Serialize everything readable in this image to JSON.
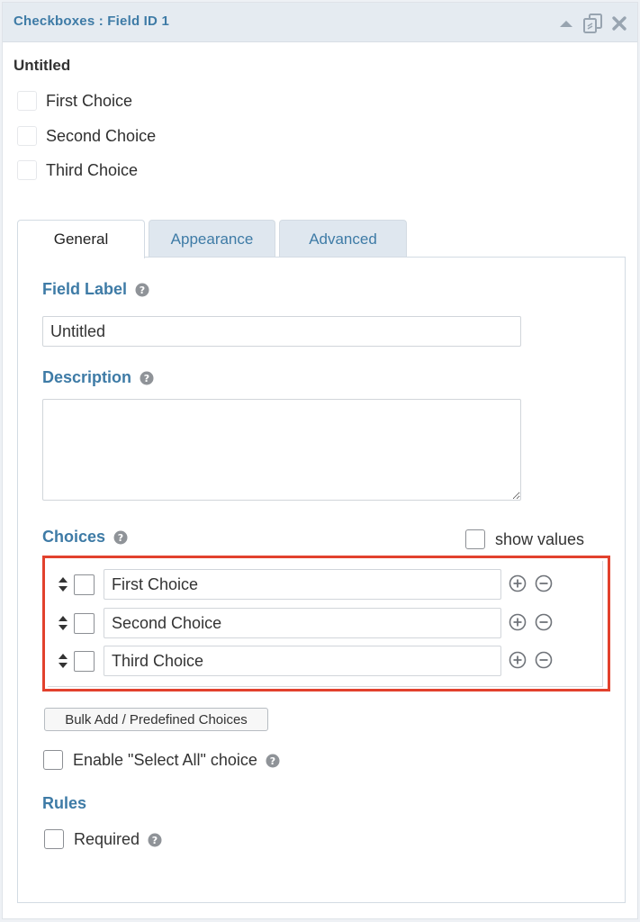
{
  "header": {
    "title": "Checkboxes : Field ID 1",
    "icons": [
      "collapse-arrow-icon",
      "duplicate-icon",
      "delete-icon"
    ]
  },
  "preview": {
    "field_title": "Untitled",
    "choices": [
      "First Choice",
      "Second Choice",
      "Third Choice"
    ]
  },
  "tabs": [
    {
      "label": "General",
      "active": true
    },
    {
      "label": "Appearance",
      "active": false
    },
    {
      "label": "Advanced",
      "active": false
    }
  ],
  "general": {
    "field_label": {
      "label": "Field Label",
      "value": "Untitled"
    },
    "description": {
      "label": "Description",
      "value": ""
    },
    "choices": {
      "label": "Choices",
      "show_values_label": "show values",
      "items": [
        "First Choice",
        "Second Choice",
        "Third Choice"
      ]
    },
    "bulk_add_label": "Bulk Add / Predefined Choices",
    "select_all_label": "Enable \"Select All\" choice",
    "rules": {
      "heading": "Rules",
      "required_label": "Required"
    }
  },
  "colors": {
    "accent": "#3e7ba6",
    "highlight": "#e2412d",
    "header_bg": "#e5ebf1",
    "inactive_tab_bg": "#dfe7ef"
  }
}
